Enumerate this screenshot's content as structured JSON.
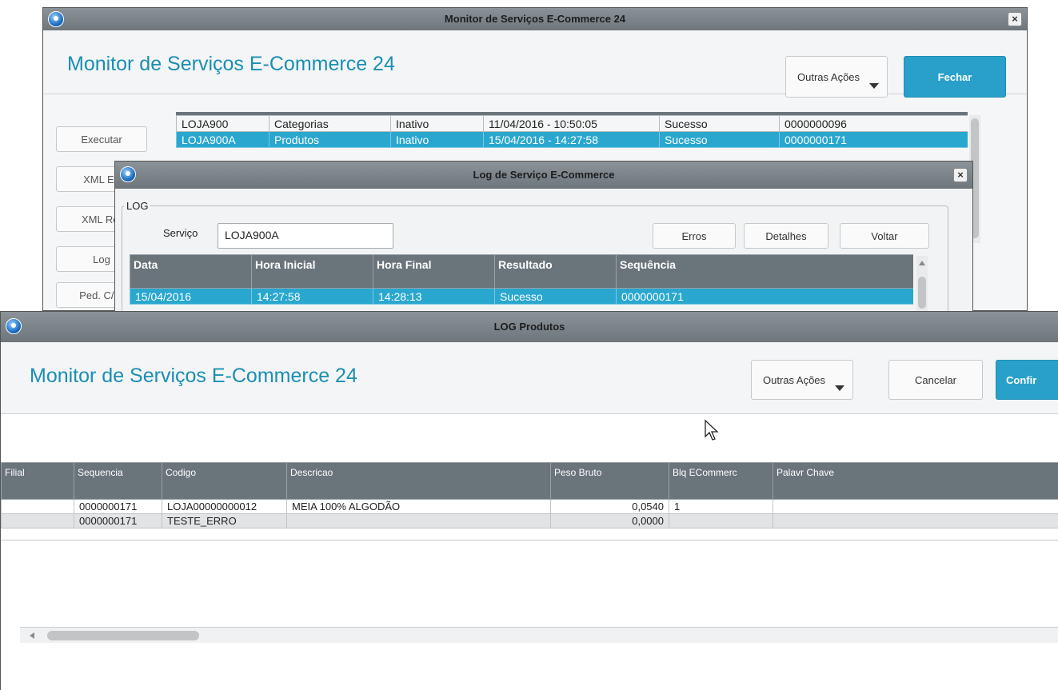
{
  "window1": {
    "title": "Monitor de Serviços E-Commerce 24",
    "app_title": "Monitor de Serviços E-Commerce 24",
    "close": "×",
    "actions": {
      "other": "Outras Ações",
      "close": "Fechar"
    },
    "side_buttons": [
      "Executar",
      "XML En",
      "XML Ret",
      "Log",
      "Ped. C/ P"
    ],
    "rows": [
      [
        "LOJA900",
        "Categorias",
        "Inativo",
        "11/04/2016 - 10:50:05",
        "Sucesso",
        "0000000096"
      ],
      [
        "LOJA900A",
        "Produtos",
        "Inativo",
        "15/04/2016 - 14:27:58",
        "Sucesso",
        "0000000171"
      ]
    ]
  },
  "window2": {
    "title": "Log de Serviço E-Commerce",
    "close": "×",
    "group_label": "LOG",
    "service_label": "Serviço",
    "service_value": "LOJA900A",
    "buttons": {
      "errors": "Erros",
      "details": "Detalhes",
      "back": "Voltar"
    },
    "columns": [
      "Data",
      "Hora Inicial",
      "Hora Final",
      "Resultado",
      "Sequência"
    ],
    "rows": [
      [
        "15/04/2016",
        "14:27:58",
        "14:28:13",
        "Sucesso",
        "0000000171"
      ]
    ]
  },
  "window3": {
    "title": "LOG Produtos",
    "app_title": "Monitor de Serviços E-Commerce 24",
    "actions": {
      "other": "Outras Ações",
      "cancel": "Cancelar",
      "confirm": "Confir"
    },
    "columns": [
      "Filial",
      "Sequencia",
      "Codigo",
      "Descricao",
      "Peso Bruto",
      "Blq ECommerc",
      "Palavr Chave"
    ],
    "rows": [
      [
        "",
        "0000000171",
        "LOJA00000000012",
        "MEIA 100% ALGODÃO",
        "0,0540",
        "1",
        ""
      ],
      [
        "",
        "0000000171",
        "TESTE_ERRO",
        "",
        "0,0000",
        "",
        ""
      ]
    ]
  },
  "colors": {
    "accent": "#29a0c9",
    "title_text": "#1a8fb3",
    "header_bg": "#6a747b",
    "selected_row": "#29a7cf"
  }
}
